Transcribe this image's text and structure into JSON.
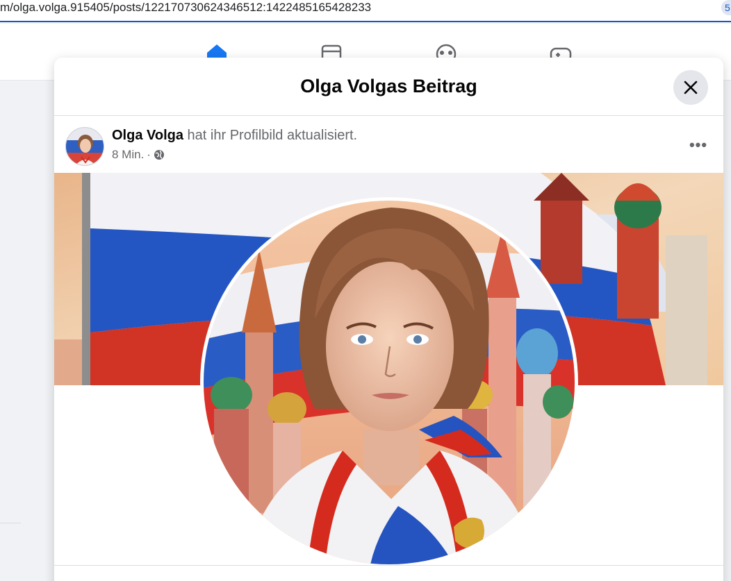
{
  "browser": {
    "url": "m/olga.volga.915405/posts/122170730624346512:1422485165428233",
    "extension_badge": "5"
  },
  "nav": {
    "icons": [
      "home-icon",
      "marketplace-icon",
      "groups-icon",
      "gaming-icon"
    ]
  },
  "modal": {
    "title": "Olga Volgas Beitrag",
    "close_label": "Schließen"
  },
  "post": {
    "author": "Olga Volga",
    "action": "hat ihr Profilbild aktualisiert.",
    "time": "8 Min.",
    "separator": "·",
    "audience_icon": "globe-icon",
    "more_label": "•••"
  },
  "colors": {
    "accent": "#1a57c4",
    "flag_white": "#f4f4f4",
    "flag_blue": "#1f4fb8",
    "flag_red": "#d52b1e"
  }
}
